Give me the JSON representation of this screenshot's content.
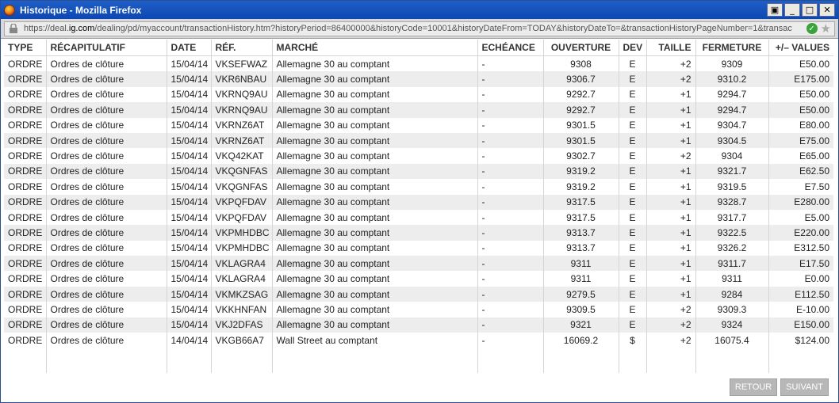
{
  "window": {
    "title": "Historique - Mozilla Firefox"
  },
  "browser": {
    "url_prefix": "https://deal.",
    "url_domain": "ig.com",
    "url_suffix": "/dealing/pd/myaccount/transactionHistory.htm?historyPeriod=86400000&historyCode=10001&historyDateFrom=TODAY&historyDateTo=&transactionHistoryPageNumber=1&transac"
  },
  "table": {
    "headers": [
      "TYPE",
      "RÉCAPITULATIF",
      "DATE",
      "RÉF.",
      "MARCHÉ",
      "ECHÉANCE",
      "OUVERTURE",
      "DEV",
      "TAILLE",
      "FERMETURE",
      "+/– VALUES"
    ],
    "rows": [
      [
        "ORDRE",
        "Ordres de clôture",
        "15/04/14",
        "VKSEFWAZ",
        "Allemagne 30 au comptant",
        "-",
        "9308",
        "E",
        "+2",
        "9309",
        "E50.00"
      ],
      [
        "ORDRE",
        "Ordres de clôture",
        "15/04/14",
        "VKR6NBAU",
        "Allemagne 30 au comptant",
        "-",
        "9306.7",
        "E",
        "+2",
        "9310.2",
        "E175.00"
      ],
      [
        "ORDRE",
        "Ordres de clôture",
        "15/04/14",
        "VKRNQ9AU",
        "Allemagne 30 au comptant",
        "-",
        "9292.7",
        "E",
        "+1",
        "9294.7",
        "E50.00"
      ],
      [
        "ORDRE",
        "Ordres de clôture",
        "15/04/14",
        "VKRNQ9AU",
        "Allemagne 30 au comptant",
        "-",
        "9292.7",
        "E",
        "+1",
        "9294.7",
        "E50.00"
      ],
      [
        "ORDRE",
        "Ordres de clôture",
        "15/04/14",
        "VKRNZ6AT",
        "Allemagne 30 au comptant",
        "-",
        "9301.5",
        "E",
        "+1",
        "9304.7",
        "E80.00"
      ],
      [
        "ORDRE",
        "Ordres de clôture",
        "15/04/14",
        "VKRNZ6AT",
        "Allemagne 30 au comptant",
        "-",
        "9301.5",
        "E",
        "+1",
        "9304.5",
        "E75.00"
      ],
      [
        "ORDRE",
        "Ordres de clôture",
        "15/04/14",
        "VKQ42KAT",
        "Allemagne 30 au comptant",
        "-",
        "9302.7",
        "E",
        "+2",
        "9304",
        "E65.00"
      ],
      [
        "ORDRE",
        "Ordres de clôture",
        "15/04/14",
        "VKQGNFAS",
        "Allemagne 30 au comptant",
        "-",
        "9319.2",
        "E",
        "+1",
        "9321.7",
        "E62.50"
      ],
      [
        "ORDRE",
        "Ordres de clôture",
        "15/04/14",
        "VKQGNFAS",
        "Allemagne 30 au comptant",
        "-",
        "9319.2",
        "E",
        "+1",
        "9319.5",
        "E7.50"
      ],
      [
        "ORDRE",
        "Ordres de clôture",
        "15/04/14",
        "VKPQFDAV",
        "Allemagne 30 au comptant",
        "-",
        "9317.5",
        "E",
        "+1",
        "9328.7",
        "E280.00"
      ],
      [
        "ORDRE",
        "Ordres de clôture",
        "15/04/14",
        "VKPQFDAV",
        "Allemagne 30 au comptant",
        "-",
        "9317.5",
        "E",
        "+1",
        "9317.7",
        "E5.00"
      ],
      [
        "ORDRE",
        "Ordres de clôture",
        "15/04/14",
        "VKPMHDBC",
        "Allemagne 30 au comptant",
        "-",
        "9313.7",
        "E",
        "+1",
        "9322.5",
        "E220.00"
      ],
      [
        "ORDRE",
        "Ordres de clôture",
        "15/04/14",
        "VKPMHDBC",
        "Allemagne 30 au comptant",
        "-",
        "9313.7",
        "E",
        "+1",
        "9326.2",
        "E312.50"
      ],
      [
        "ORDRE",
        "Ordres de clôture",
        "15/04/14",
        "VKLAGRA4",
        "Allemagne 30 au comptant",
        "-",
        "9311",
        "E",
        "+1",
        "9311.7",
        "E17.50"
      ],
      [
        "ORDRE",
        "Ordres de clôture",
        "15/04/14",
        "VKLAGRA4",
        "Allemagne 30 au comptant",
        "-",
        "9311",
        "E",
        "+1",
        "9311",
        "E0.00"
      ],
      [
        "ORDRE",
        "Ordres de clôture",
        "15/04/14",
        "VKMKZSAG",
        "Allemagne 30 au comptant",
        "-",
        "9279.5",
        "E",
        "+1",
        "9284",
        "E112.50"
      ],
      [
        "ORDRE",
        "Ordres de clôture",
        "15/04/14",
        "VKKHNFAN",
        "Allemagne 30 au comptant",
        "-",
        "9309.5",
        "E",
        "+2",
        "9309.3",
        "E-10.00"
      ],
      [
        "ORDRE",
        "Ordres de clôture",
        "15/04/14",
        "VKJ2DFAS",
        "Allemagne 30 au comptant",
        "-",
        "9321",
        "E",
        "+2",
        "9324",
        "E150.00"
      ],
      [
        "ORDRE",
        "Ordres de clôture",
        "14/04/14",
        "VKGB66A7",
        "Wall Street au comptant",
        "-",
        "16069.2",
        "$",
        "+2",
        "16075.4",
        "$124.00"
      ]
    ]
  },
  "buttons": {
    "back": "RETOUR",
    "next": "SUIVANT"
  },
  "icons": {
    "browser": "firefox-icon",
    "lock": "lock-icon",
    "verified": "check-icon",
    "bookmark": "star-icon"
  }
}
